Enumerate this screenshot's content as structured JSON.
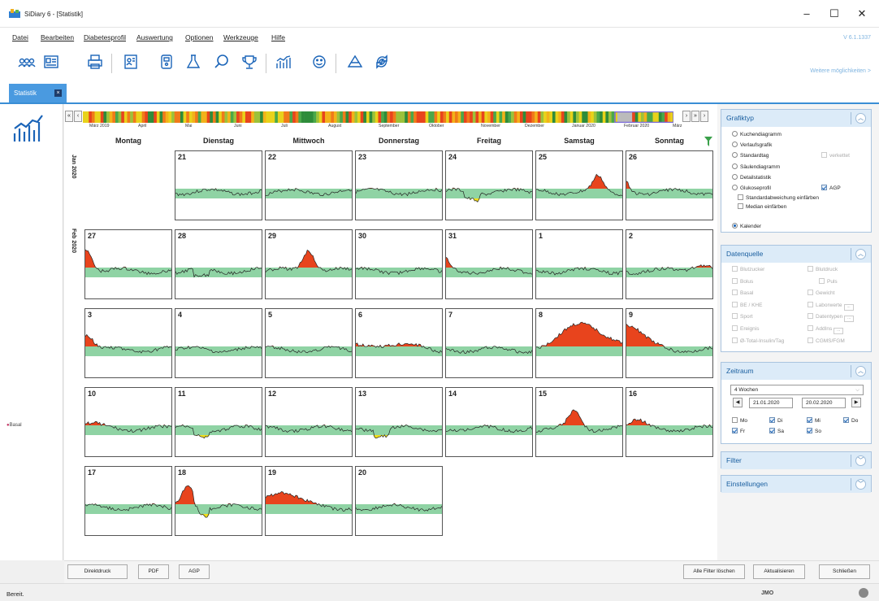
{
  "window": {
    "title": "SiDiary 6 - [Statistik]",
    "version": "V 6.1.1337"
  },
  "menu": [
    "Datei",
    "Bearbeiten",
    "Diabetesprofil",
    "Auswertung",
    "Optionen",
    "Werkzeuge",
    "Hilfe"
  ],
  "toolbar": {
    "weitere": "Weitere möglichkeiten >"
  },
  "tab": {
    "label": "Statistik"
  },
  "left": {
    "legend": "Basal"
  },
  "timeline": {
    "months": [
      "März 2019",
      "April",
      "Mai",
      "Juni",
      "Juli",
      "August",
      "September",
      "Oktober",
      "November",
      "Dezember",
      "Januar 2020",
      "Februar 2020",
      "März"
    ]
  },
  "calendar": {
    "weekdays": [
      "Montag",
      "Dienstag",
      "Mittwoch",
      "Donnerstag",
      "Freitag",
      "Samstag",
      "Sonntag"
    ],
    "month_labels": [
      "Jan 2020",
      "Feb 2020"
    ],
    "weeks": [
      [
        null,
        "21",
        "22",
        "23",
        "24",
        "25",
        "26"
      ],
      [
        "27",
        "28",
        "29",
        "30",
        "31",
        "1",
        "2"
      ],
      [
        "3",
        "4",
        "5",
        "6",
        "7",
        "8",
        "9"
      ],
      [
        "10",
        "11",
        "12",
        "13",
        "14",
        "15",
        "16"
      ],
      [
        "17",
        "18",
        "19",
        "20",
        null,
        null,
        null
      ]
    ]
  },
  "grafiktyp": {
    "title": "Grafiktyp",
    "options": [
      {
        "label": "Kuchendiagramm",
        "selected": false
      },
      {
        "label": "Verlaufsgrafik",
        "selected": false
      },
      {
        "label": "Standardtag",
        "selected": false
      },
      {
        "label": "Säulendiagramm",
        "selected": false
      },
      {
        "label": "Detailstatistik",
        "selected": false
      },
      {
        "label": "Glukoseprofil",
        "selected": false
      },
      {
        "label": "Kalender",
        "selected": true
      }
    ],
    "verkettet": "verkettet",
    "agp": "AGP",
    "std_faerben": "Standardabweichung einfärben",
    "median_faerben": "Median einfärben"
  },
  "datenquelle": {
    "title": "Datenquelle",
    "left": [
      "Blutzucker",
      "Bolus",
      "Basal",
      "BE / KHE",
      "Sport",
      "Ereignis",
      "Ø-Total-Insulin/Tag"
    ],
    "right": [
      "Blutdruck",
      "Puls",
      "Gewicht",
      "Laborwerte",
      "Datentypen",
      "AddIns",
      "CGMS/FGM"
    ]
  },
  "zeitraum": {
    "title": "Zeitraum",
    "period": "4 Wochen",
    "from": "21.01.2020",
    "to": "20.02.2020",
    "days": [
      {
        "label": "Mo",
        "checked": false
      },
      {
        "label": "Di",
        "checked": true
      },
      {
        "label": "Mi",
        "checked": true
      },
      {
        "label": "Do",
        "checked": true
      },
      {
        "label": "Fr",
        "checked": true
      },
      {
        "label": "Sa",
        "checked": true
      },
      {
        "label": "So",
        "checked": true
      }
    ]
  },
  "filter": {
    "title": "Filter"
  },
  "einstellungen": {
    "title": "Einstellungen"
  },
  "buttons": {
    "direktdruck": "Direktdruck",
    "pdf": "PDF",
    "agp": "AGP",
    "alle_filter": "Alle Filter löschen",
    "aktualisieren": "Aktualisieren",
    "schliessen": "Schließen"
  },
  "status": {
    "text": "Bereit.",
    "user": "JMO"
  },
  "colors": {
    "accent": "#3a8ed5",
    "target_band": "#8fd3a4",
    "high": "#e8441d",
    "low": "#f2dd1a"
  }
}
